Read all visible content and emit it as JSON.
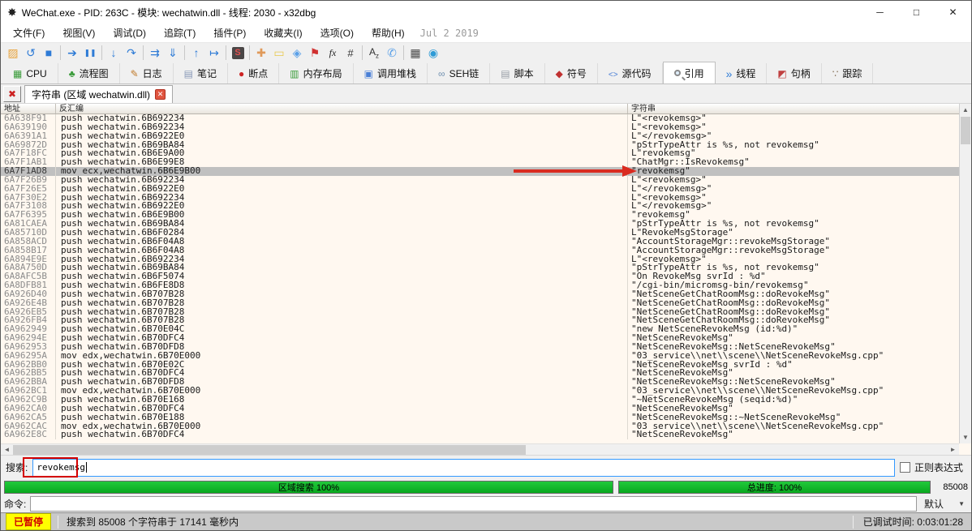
{
  "window": {
    "title": "WeChat.exe - PID: 263C - 模块: wechatwin.dll - 线程: 2030 - x32dbg",
    "controls": [
      {
        "name": "minimize-button",
        "icon": "minimize-icon"
      },
      {
        "name": "maximize-button",
        "icon": "maximize-icon"
      },
      {
        "name": "close-button",
        "icon": "close-icon"
      }
    ]
  },
  "menu": {
    "items": [
      "文件(F)",
      "视图(V)",
      "调试(D)",
      "追踪(T)",
      "插件(P)",
      "收藏夹(I)",
      "选项(O)",
      "帮助(H)"
    ],
    "build_date": "Jul 2 2019"
  },
  "toolbar": {
    "icons": [
      {
        "name": "open-folder-icon"
      },
      {
        "name": "restart-icon"
      },
      {
        "name": "stop-icon"
      },
      {
        "name": "separator"
      },
      {
        "name": "run-icon"
      },
      {
        "name": "pause-icon"
      },
      {
        "name": "separator"
      },
      {
        "name": "step-into-icon"
      },
      {
        "name": "step-over-icon"
      },
      {
        "name": "separator"
      },
      {
        "name": "run-until-icon"
      },
      {
        "name": "execute-till-return-icon"
      },
      {
        "name": "separator"
      },
      {
        "name": "step-out-icon"
      },
      {
        "name": "run-to-user-code-icon"
      },
      {
        "name": "separator"
      },
      {
        "name": "seh-breakpoint-icon"
      },
      {
        "name": "separator"
      },
      {
        "name": "patches-icon"
      },
      {
        "name": "comments-icon"
      },
      {
        "name": "labels-icon"
      },
      {
        "name": "bookmarks-icon"
      },
      {
        "name": "functions-icon"
      },
      {
        "name": "hash-icon"
      },
      {
        "name": "separator"
      },
      {
        "name": "strings-icon"
      },
      {
        "name": "modules-icon"
      },
      {
        "name": "separator"
      },
      {
        "name": "calculator-icon"
      },
      {
        "name": "internet-icon"
      }
    ]
  },
  "tabs": [
    {
      "label": "CPU",
      "icon": "cpu-icon",
      "active": false
    },
    {
      "label": "流程图",
      "icon": "graph-icon",
      "active": false
    },
    {
      "label": "日志",
      "icon": "log-icon",
      "active": false
    },
    {
      "label": "笔记",
      "icon": "notes-icon",
      "active": false
    },
    {
      "label": "断点",
      "icon": "breakpoints-icon",
      "active": false
    },
    {
      "label": "内存布局",
      "icon": "memory-map-icon",
      "active": false
    },
    {
      "label": "调用堆栈",
      "icon": "call-stack-icon",
      "active": false
    },
    {
      "label": "SEH链",
      "icon": "seh-chain-icon",
      "active": false
    },
    {
      "label": "脚本",
      "icon": "script-icon",
      "active": false
    },
    {
      "label": "符号",
      "icon": "symbols-icon",
      "active": false
    },
    {
      "label": "源代码",
      "icon": "source-icon",
      "active": false
    },
    {
      "label": "引用",
      "icon": "references-icon",
      "active": true
    },
    {
      "label": "线程",
      "icon": "threads-icon",
      "active": false
    },
    {
      "label": "句柄",
      "icon": "handles-icon",
      "active": false
    },
    {
      "label": "跟踪",
      "icon": "trace-icon",
      "active": false
    }
  ],
  "subtab": {
    "title": "字符串 (区域 wechatwin.dll)"
  },
  "table": {
    "columns": [
      "地址",
      "反汇编",
      "字符串"
    ],
    "search_term": "revokemsg",
    "selected_index": 6,
    "rows": [
      [
        "6A638F91",
        "push wechatwin.6B692234",
        "L\"<revokemsg>\""
      ],
      [
        "6A639190",
        "push wechatwin.6B692234",
        "L\"<revokemsg>\""
      ],
      [
        "6A6391A1",
        "push wechatwin.6B6922E0",
        "L\"</revokemsg>\""
      ],
      [
        "6A69872D",
        "push wechatwin.6B69BA84",
        "\"pStrTypeAttr is %s, not revokemsg\""
      ],
      [
        "6A7F18FC",
        "push wechatwin.6B6E9A00",
        "L\"revokemsg\""
      ],
      [
        "6A7F1AB1",
        "push wechatwin.6B6E99E8",
        "\"ChatMgr::IsRevokemsg\""
      ],
      [
        "6A7F1AD8",
        "mov ecx,wechatwin.6B6E9B00",
        "\"revokemsg\""
      ],
      [
        "6A7F26B9",
        "push wechatwin.6B692234",
        "L\"<revokemsg>\""
      ],
      [
        "6A7F26E5",
        "push wechatwin.6B6922E0",
        "L\"</revokemsg>\""
      ],
      [
        "6A7F30E2",
        "push wechatwin.6B692234",
        "L\"<revokemsg>\""
      ],
      [
        "6A7F3108",
        "push wechatwin.6B6922E0",
        "L\"</revokemsg>\""
      ],
      [
        "6A7F6395",
        "push wechatwin.6B6E9B00",
        "\"revokemsg\""
      ],
      [
        "6A81CAEA",
        "push wechatwin.6B69BA84",
        "\"pStrTypeAttr is %s, not revokemsg\""
      ],
      [
        "6A85710D",
        "push wechatwin.6B6F0284",
        "L\"RevokeMsgStorage\""
      ],
      [
        "6A858ACD",
        "push wechatwin.6B6F04A8",
        "\"AccountStorageMgr::revokeMsgStorage\""
      ],
      [
        "6A858B17",
        "push wechatwin.6B6F04A8",
        "\"AccountStorageMgr::revokeMsgStorage\""
      ],
      [
        "6A894E9E",
        "push wechatwin.6B692234",
        "L\"<revokemsg>\""
      ],
      [
        "6A8A750D",
        "push wechatwin.6B69BA84",
        "\"pStrTypeAttr is %s, not revokemsg\""
      ],
      [
        "6A8AFC5B",
        "push wechatwin.6B6F5074",
        "\"On RevokeMsg svrId : %d\""
      ],
      [
        "6A8DFB81",
        "push wechatwin.6B6FE8D8",
        "\"/cgi-bin/micromsg-bin/revokemsg\""
      ],
      [
        "6A926D40",
        "push wechatwin.6B707B28",
        "\"NetSceneGetChatRoomMsg::doRevokeMsg\""
      ],
      [
        "6A926E4B",
        "push wechatwin.6B707B28",
        "\"NetSceneGetChatRoomMsg::doRevokeMsg\""
      ],
      [
        "6A926EB5",
        "push wechatwin.6B707B28",
        "\"NetSceneGetChatRoomMsg::doRevokeMsg\""
      ],
      [
        "6A926FB4",
        "push wechatwin.6B707B28",
        "\"NetSceneGetChatRoomMsg::doRevokeMsg\""
      ],
      [
        "6A962949",
        "push wechatwin.6B70E04C",
        "\"new NetSceneRevokeMsg (id:%d)\""
      ],
      [
        "6A96294E",
        "push wechatwin.6B70DFC4",
        "\"NetSceneRevokeMsg\""
      ],
      [
        "6A962953",
        "push wechatwin.6B70DFD8",
        "\"NetSceneRevokeMsg::NetSceneRevokeMsg\""
      ],
      [
        "6A96295A",
        "mov edx,wechatwin.6B70E000",
        "\"03_service\\\\net\\\\scene\\\\NetSceneRevokeMsg.cpp\""
      ],
      [
        "6A962BB0",
        "push wechatwin.6B70E02C",
        "\"NetSceneRevokeMsg svrId : %d\""
      ],
      [
        "6A962BB5",
        "push wechatwin.6B70DFC4",
        "\"NetSceneRevokeMsg\""
      ],
      [
        "6A962BBA",
        "push wechatwin.6B70DFD8",
        "\"NetSceneRevokeMsg::NetSceneRevokeMsg\""
      ],
      [
        "6A962BC1",
        "mov edx,wechatwin.6B70E000",
        "\"03_service\\\\net\\\\scene\\\\NetSceneRevokeMsg.cpp\""
      ],
      [
        "6A962C9B",
        "push wechatwin.6B70E168",
        "\"~NetSceneRevokeMsg (seqid:%d)\""
      ],
      [
        "6A962CA0",
        "push wechatwin.6B70DFC4",
        "\"NetSceneRevokeMsg\""
      ],
      [
        "6A962CA5",
        "push wechatwin.6B70E188",
        "\"NetSceneRevokeMsg::~NetSceneRevokeMsg\""
      ],
      [
        "6A962CAC",
        "mov edx,wechatwin.6B70E000",
        "\"03_service\\\\net\\\\scene\\\\NetSceneRevokeMsg.cpp\""
      ],
      [
        "6A962E8C",
        "push wechatwin.6B70DFC4",
        "\"NetSceneRevokeMsg\""
      ]
    ]
  },
  "search": {
    "label": "搜索:",
    "value": "revokemsg",
    "regex_label": "正则表达式",
    "regex_checked": false
  },
  "progress": {
    "region_label": "区域搜索 100%",
    "total_label": "总进度: 100%",
    "count": "85008",
    "bar_color": "#0cb025"
  },
  "command": {
    "label": "命令:",
    "value": "",
    "profile": "默认"
  },
  "status": {
    "state": "已暂停",
    "message": "搜索到 85008 个字符串于 17141 毫秒内",
    "time": "已调试时间: 0:03:01:28",
    "state_bg": "#ffff00",
    "state_color": "#d00000"
  },
  "annotations": {
    "arrow_color": "#d92b20",
    "box_color": "#d40000"
  }
}
